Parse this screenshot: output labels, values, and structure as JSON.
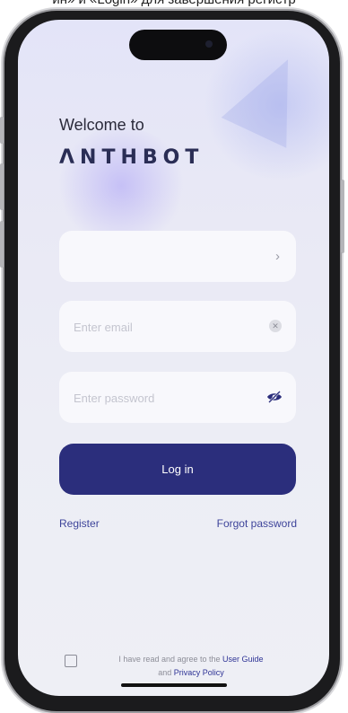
{
  "top_caption": "ин» и «Login» для завершения регистр",
  "welcome": {
    "heading": "Welcome to",
    "brand": "ΛNTHBOT"
  },
  "form": {
    "region_chevron": "›",
    "email_placeholder": "Enter email",
    "password_placeholder": "Enter password",
    "login_label": "Log in"
  },
  "links": {
    "register": "Register",
    "forgot": "Forgot password"
  },
  "agreement": {
    "prefix": "I have read and agree to the",
    "user_guide": "User Guide",
    "and": "and",
    "privacy": "Privacy Policy"
  },
  "icons": {
    "clear": "clear-icon",
    "eye": "eye-hidden-icon",
    "chevron": "chevron-right-icon"
  },
  "colors": {
    "primary": "#2b2e7c",
    "link": "#3e449a"
  }
}
